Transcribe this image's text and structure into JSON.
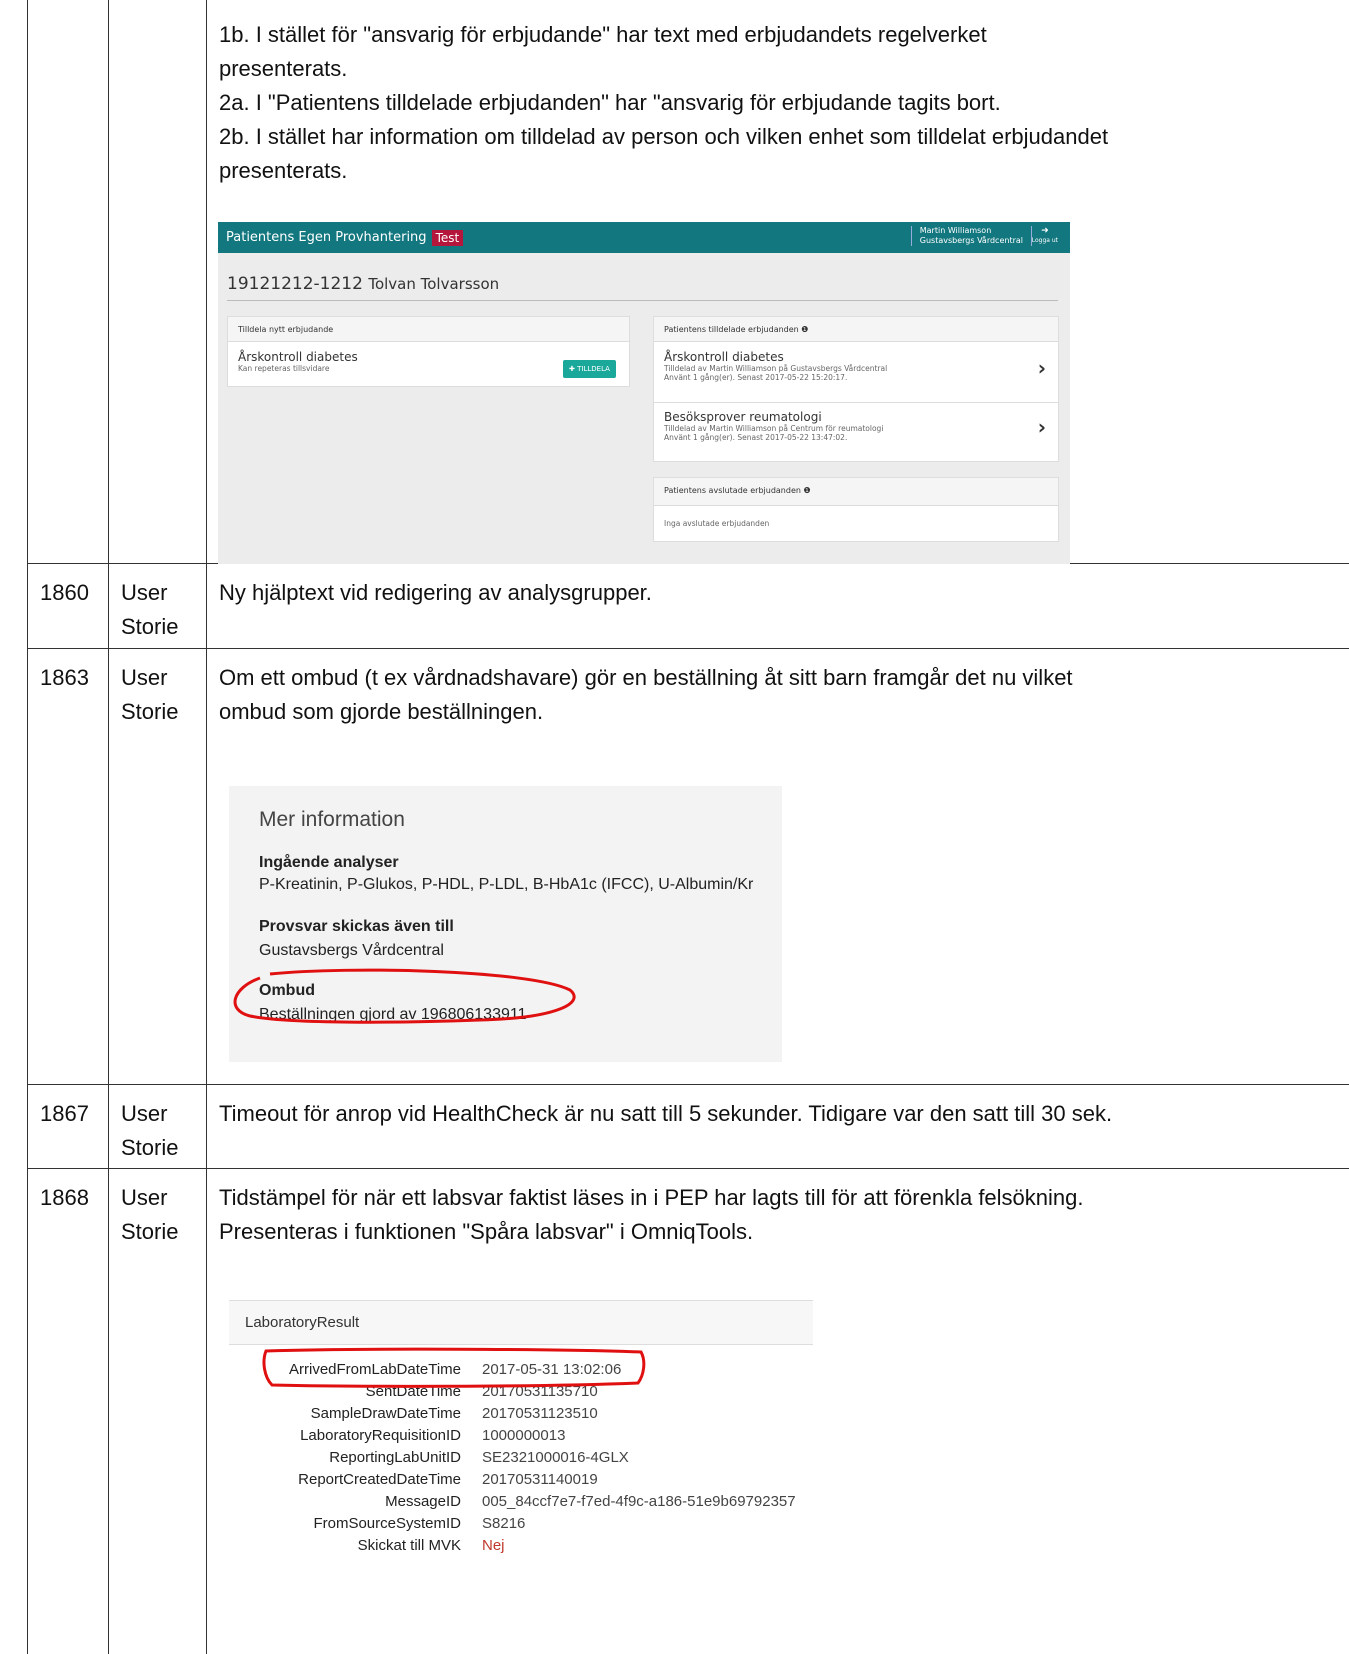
{
  "rows": [
    {
      "number": "",
      "type": "",
      "lines": [
        "1b. I stället för \"ansvarig för erbjudande\" har text med erbjudandets regelverket",
        "presenterats.",
        "2a. I \"Patientens tilldelade erbjudanden\" har \"ansvarig för erbjudande tagits bort.",
        "2b. I stället har information om tilldelad av person och vilken enhet som tilldelat erbjudandet",
        "presenterats."
      ]
    },
    {
      "number": "1860",
      "type": "User Storie",
      "text": "Ny hjälptext vid redigering av analysgrupper."
    },
    {
      "number": "1863",
      "type": "User Storie",
      "lines": [
        "Om ett ombud (t ex vårdnadshavare) gör en beställning åt sitt barn framgår det nu vilket",
        "ombud som gjorde beställningen."
      ]
    },
    {
      "number": "1867",
      "type": "User Storie",
      "text": "Timeout för anrop vid HealthCheck är nu satt till 5 sekunder. Tidigare var den satt till 30 sek."
    },
    {
      "number": "1868",
      "type": "User Storie",
      "lines": [
        "Tidstämpel för när ett labsvar faktist läses in i PEP har lagts till för att förenkla felsökning.",
        "Presenteras i funktionen \"Spåra labsvar\" i OmniqTools."
      ]
    }
  ],
  "type_parts": [
    "User",
    "Storie"
  ],
  "pep": {
    "app_title": "Patientens Egen Provhantering",
    "env_tag": "Test",
    "user_name": "Martin Williamson",
    "user_unit": "Gustavsbergs Vårdcentral",
    "logout": "Logga ut",
    "patient": "19121212-1212",
    "patient_name": "Tolvan Tolvarsson",
    "new_offer_head": "Tilldela nytt erbjudande",
    "new_offer_title": "Årskontroll diabetes",
    "new_offer_sub": "Kan repeteras tillsvidare",
    "assign_button": "TILLDELA",
    "assigned_head": "Patientens tilldelade erbjudanden",
    "assigned": [
      {
        "title": "Årskontroll diabetes",
        "by": "Tilldelad av Martin Williamson på Gustavsbergs Vårdcentral",
        "used": "Använt 1 gång(er). Senast 2017-05-22 15:20:17."
      },
      {
        "title": "Besöksprover reumatologi",
        "by": "Tilldelad av Martin Williamson på Centrum för reumatologi",
        "used": "Använt 1 gång(er). Senast 2017-05-22 13:47:02."
      }
    ],
    "finished_head": "Patientens avslutade erbjudanden",
    "finished_empty": "Inga avslutade erbjudanden"
  },
  "mer_information": {
    "title": "Mer information",
    "analyses_label": "Ingående analyser",
    "analyses_value": "P-Kreatinin, P-Glukos, P-HDL, P-LDL, B-HbA1c (IFCC), U-Albumin/Kr",
    "sent_label": "Provsvar skickas även till",
    "sent_value": "Gustavsbergs Vårdcentral",
    "agent_label": "Ombud",
    "agent_value": "Beställningen gjord av 196806133911"
  },
  "laboratory_result": {
    "title": "LaboratoryResult",
    "fields": [
      {
        "key": "ArrivedFromLabDateTime",
        "value": "2017-05-31 13:02:06"
      },
      {
        "key": "SentDateTime",
        "value": "20170531135710"
      },
      {
        "key": "SampleDrawDateTime",
        "value": "20170531123510"
      },
      {
        "key": "LaboratoryRequisitionID",
        "value": "1000000013"
      },
      {
        "key": "ReportingLabUnitID",
        "value": "SE2321000016-4GLX"
      },
      {
        "key": "ReportCreatedDateTime",
        "value": "20170531140019"
      },
      {
        "key": "MessageID",
        "value": "005_84ccf7e7-f7ed-4f9c-a186-51e9b69792357"
      },
      {
        "key": "FromSourceSystemID",
        "value": "S8216"
      },
      {
        "key": "Skickat till MVK",
        "value": "Nej"
      }
    ]
  },
  "colors": {
    "pep_bar": "#12777f",
    "test_tag": "#b5163b",
    "assign_button": "#1aa89a",
    "highlight": "#e01010",
    "nej": "#c0392b"
  }
}
